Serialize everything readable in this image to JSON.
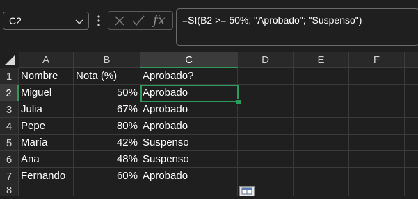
{
  "name_box": {
    "value": "C2"
  },
  "formula_bar": {
    "fx_label": "fx",
    "formula": "=SI(B2 >= 50%; \"Aprobado\"; \"Suspenso\")"
  },
  "columns": [
    "A",
    "B",
    "C",
    "D",
    "E",
    "F"
  ],
  "rows": [
    "1",
    "2",
    "3",
    "4",
    "5",
    "6",
    "7",
    "8"
  ],
  "cells": {
    "A1": "Nombre",
    "B1": "Nota (%)",
    "C1": "Aprobado?",
    "A2": "Miguel",
    "B2": "50%",
    "C2": "Aprobado",
    "A3": "Julia",
    "B3": "67%",
    "C3": "Aprobado",
    "A4": "Pepe",
    "B4": "80%",
    "C4": "Aprobado",
    "A5": "María",
    "B5": "42%",
    "C5": "Suspenso",
    "A6": "Ana",
    "B6": "48%",
    "C6": "Suspenso",
    "A7": "Fernando",
    "B7": "60%",
    "C7": "Aprobado"
  },
  "colors": {
    "accent": "#2e9a5b",
    "background": "#1f1f1f",
    "header": "#292929"
  }
}
